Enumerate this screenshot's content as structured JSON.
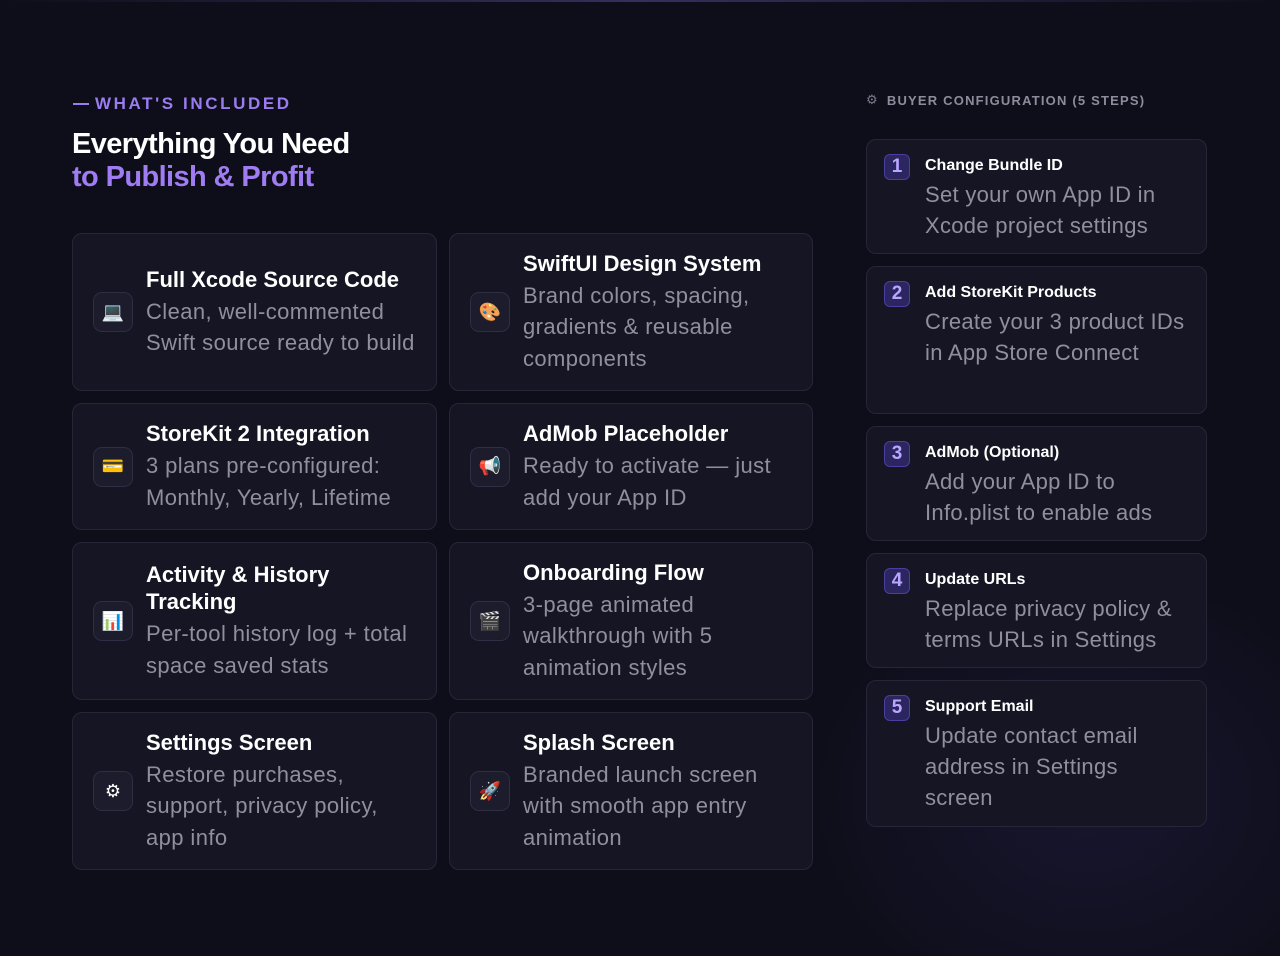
{
  "header": {
    "eyebrow": "WHAT'S INCLUDED",
    "title_line1": "Everything You Need",
    "title_line2": "to Publish & Profit"
  },
  "features": [
    {
      "icon": "laptop-icon",
      "glyph": "💻",
      "title": "Full Xcode Source Code",
      "desc": "Clean, well-commented Swift source ready to build"
    },
    {
      "icon": "palette-icon",
      "glyph": "🎨",
      "title": "SwiftUI Design System",
      "desc": "Brand colors, spacing, gradients & reusable components"
    },
    {
      "icon": "credit-card-icon",
      "glyph": "💳",
      "title": "StoreKit 2 Integration",
      "desc": "3 plans pre-configured: Monthly, Yearly, Lifetime"
    },
    {
      "icon": "megaphone-icon",
      "glyph": "📢",
      "title": "AdMob Placeholder",
      "desc": "Ready to activate — just add your App ID"
    },
    {
      "icon": "bar-chart-icon",
      "glyph": "📊",
      "title": "Activity & History Tracking",
      "desc": "Per-tool history log + total space saved stats"
    },
    {
      "icon": "clapperboard-icon",
      "glyph": "🎬",
      "title": "Onboarding Flow",
      "desc": "3-page animated walkthrough with 5 animation styles"
    },
    {
      "icon": "gear-icon",
      "glyph": "⚙",
      "title": "Settings Screen",
      "desc": "Restore purchases, support, privacy policy, app info"
    },
    {
      "icon": "rocket-icon",
      "glyph": "🚀",
      "title": "Splash Screen",
      "desc": "Branded launch screen with smooth app entry animation"
    }
  ],
  "config": {
    "heading": "BUYER CONFIGURATION (5 STEPS)",
    "heading_icon": "gear-icon",
    "steps": [
      {
        "num": "1",
        "title": "Change Bundle ID",
        "desc": "Set your own App ID in Xcode project settings"
      },
      {
        "num": "2",
        "title": "Add StoreKit Products",
        "desc": "Create your 3 product IDs in App Store Connect"
      },
      {
        "num": "3",
        "title": "AdMob (Optional)",
        "desc": "Add your App ID to Info.plist to enable ads"
      },
      {
        "num": "4",
        "title": "Update URLs",
        "desc": "Replace privacy policy & terms URLs in Settings"
      },
      {
        "num": "5",
        "title": "Support Email",
        "desc": "Update contact email address in Settings screen"
      }
    ]
  },
  "colors": {
    "background": "#0e0e1a",
    "accent": "#a07cf2",
    "card": "#151523",
    "muted_text": "#8f8f9e"
  }
}
